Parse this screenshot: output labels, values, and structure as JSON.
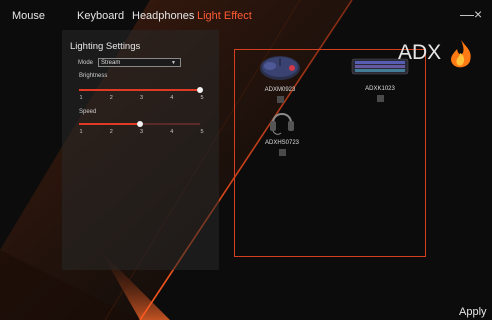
{
  "tabs": [
    {
      "label": "Mouse",
      "active": false
    },
    {
      "label": "Keyboard",
      "active": false
    },
    {
      "label": "Headphones",
      "active": false
    },
    {
      "label": "Light Effect",
      "active": true
    }
  ],
  "window_controls": {
    "minimize": "—",
    "close": "×"
  },
  "lighting": {
    "title": "Lighting Settings",
    "mode_label": "Mode",
    "mode_value": "Stream",
    "brightness_label": "Brightness",
    "brightness_value": 5,
    "speed_label": "Speed",
    "speed_value": 3,
    "scale_min": 1,
    "scale_max": 5,
    "tick_labels": [
      "1",
      "2",
      "3",
      "4",
      "5"
    ]
  },
  "devices": [
    {
      "name": "ADXM0923",
      "icon": "mouse-icon"
    },
    {
      "name": "ADXK1023",
      "icon": "keyboard-icon"
    },
    {
      "name": "ADXHS0723",
      "icon": "headset-icon"
    }
  ],
  "brand": {
    "logo_text": "ADX",
    "logo_icon": "flame-icon"
  },
  "colors": {
    "accent": "#ff5a34",
    "border": "#d2401f",
    "background": "#0c0c0c"
  },
  "apply_label": "Apply"
}
